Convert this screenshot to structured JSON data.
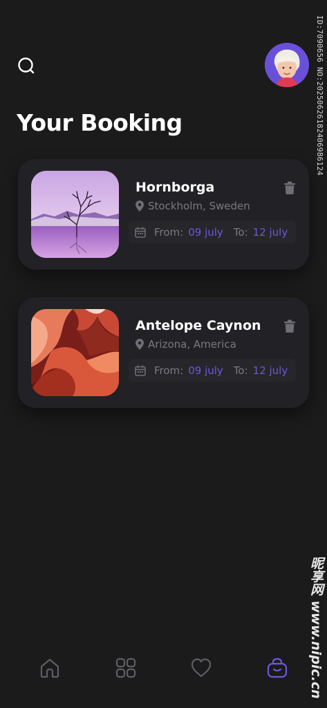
{
  "header": {
    "title": "Your Booking"
  },
  "bookings": [
    {
      "name": "Hornborga",
      "location": "Stockholm, Sweden",
      "from_label": "From:",
      "from_value": "09 july",
      "to_label": "To:",
      "to_value": "12 july"
    },
    {
      "name": "Antelope Caynon",
      "location": "Arizona, America",
      "from_label": "From:",
      "from_value": "09 july",
      "to_label": "To:",
      "to_value": "12 july"
    }
  ],
  "bottom_nav": {
    "items": [
      {
        "icon": "home-icon",
        "active": false
      },
      {
        "icon": "grid-icon",
        "active": false
      },
      {
        "icon": "heart-icon",
        "active": false
      },
      {
        "icon": "bag-icon",
        "active": true
      }
    ]
  },
  "watermark": {
    "id_text": "ID:7090656 NO:20250626182406986124",
    "site_text": "昵享网 www.nipic.cn"
  },
  "colors": {
    "background": "#1b1b1c",
    "card": "#222125",
    "accent": "#6d58e0",
    "muted_text": "#7a7a80"
  }
}
